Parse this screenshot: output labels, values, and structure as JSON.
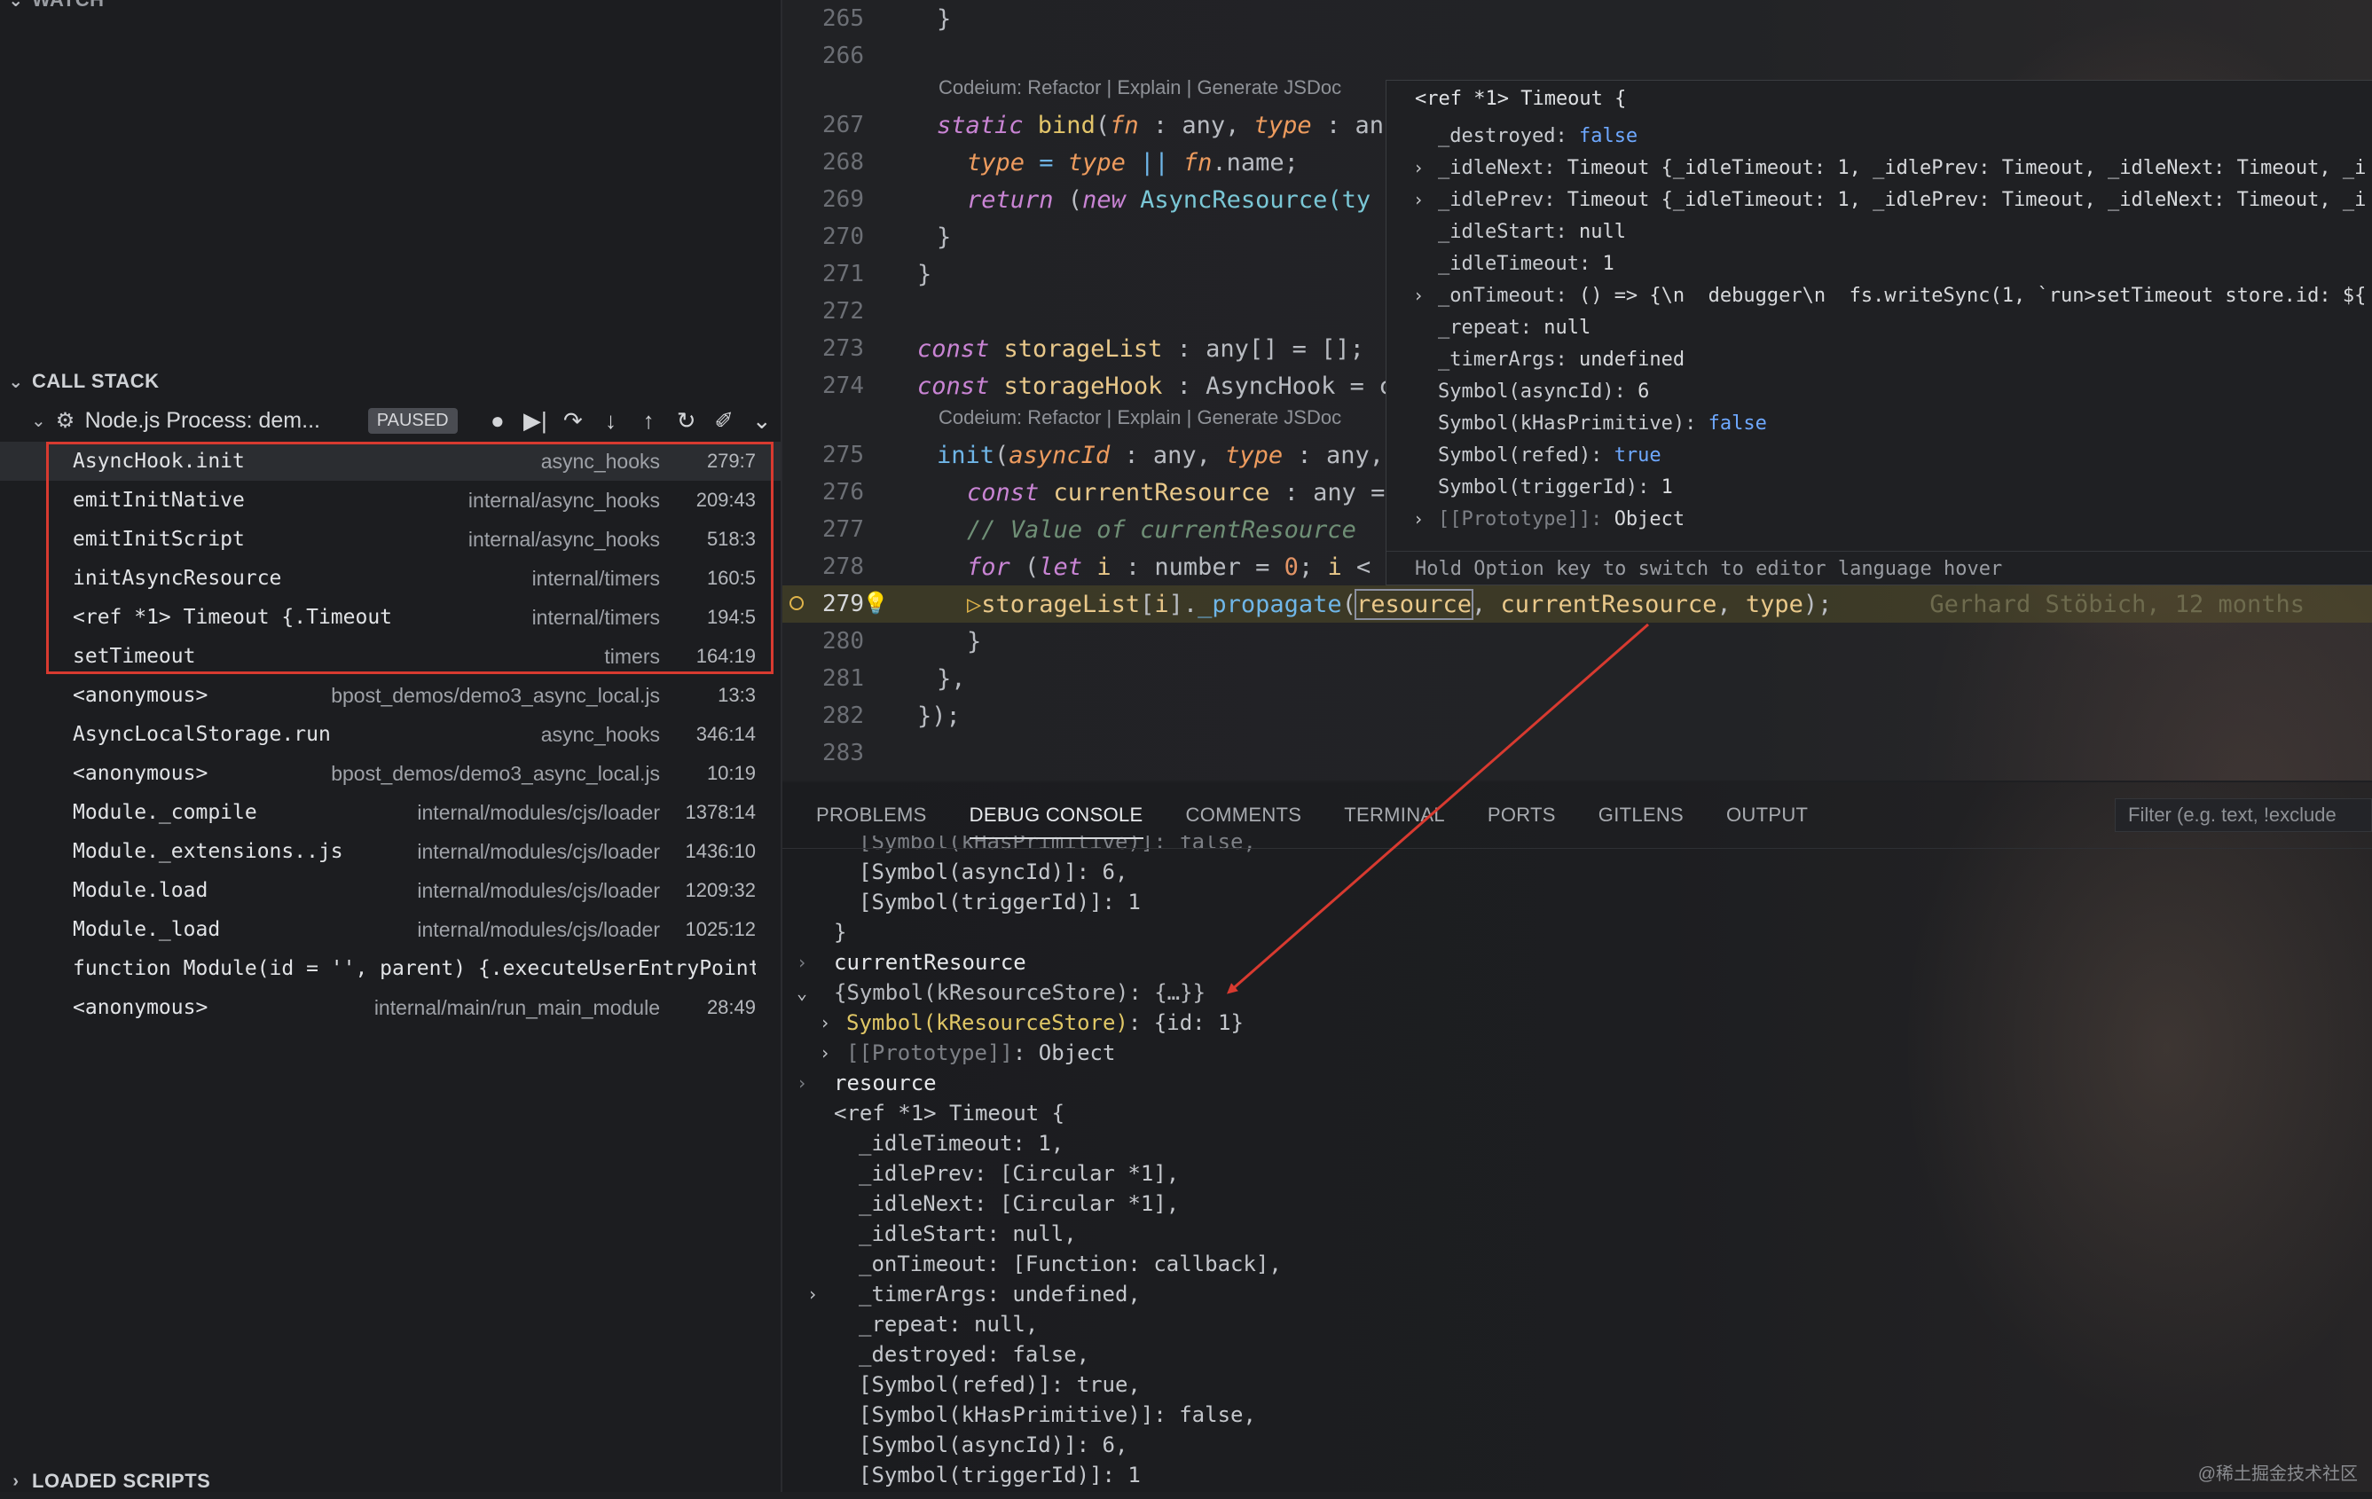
{
  "sidebar": {
    "watch_label": "WATCH",
    "callstack_label": "CALL STACK",
    "loaded_scripts_label": "LOADED SCRIPTS",
    "process_name": "Node.js Process: dem...",
    "status_badge": "PAUSED",
    "frames": [
      {
        "fn": "AsyncHook.init",
        "src": "async_hooks",
        "pos": "279:7"
      },
      {
        "fn": "emitInitNative",
        "src": "internal/async_hooks",
        "pos": "209:43"
      },
      {
        "fn": "emitInitScript",
        "src": "internal/async_hooks",
        "pos": "518:3"
      },
      {
        "fn": "initAsyncResource",
        "src": "internal/timers",
        "pos": "160:5"
      },
      {
        "fn": "<ref *1> Timeout {.Timeout",
        "src": "internal/timers",
        "pos": "194:5"
      },
      {
        "fn": "setTimeout",
        "src": "timers",
        "pos": "164:19"
      },
      {
        "fn": "<anonymous>",
        "src": "bpost_demos/demo3_async_local.js",
        "pos": "13:3"
      },
      {
        "fn": "AsyncLocalStorage.run",
        "src": "async_hooks",
        "pos": "346:14"
      },
      {
        "fn": "<anonymous>",
        "src": "bpost_demos/demo3_async_local.js",
        "pos": "10:19"
      },
      {
        "fn": "Module._compile",
        "src": "internal/modules/cjs/loader",
        "pos": "1378:14"
      },
      {
        "fn": "Module._extensions..js",
        "src": "internal/modules/cjs/loader",
        "pos": "1436:10"
      },
      {
        "fn": "Module.load",
        "src": "internal/modules/cjs/loader",
        "pos": "1209:32"
      },
      {
        "fn": "Module._load",
        "src": "internal/modules/cjs/loader",
        "pos": "1025:12"
      },
      {
        "fn": "function Module(id = '', parent) {.executeUserEntryPoint",
        "src": "",
        "pos": ""
      },
      {
        "fn": "<anonymous>",
        "src": "internal/main/run_main_module",
        "pos": "28:49"
      }
    ]
  },
  "editor": {
    "line_numbers": [
      "265",
      "266",
      "267",
      "268",
      "269",
      "270",
      "271",
      "272",
      "273",
      "274",
      "275",
      "276",
      "277",
      "278",
      "279",
      "280",
      "281",
      "282",
      "283"
    ],
    "codelens": "Codeium: Refactor | Explain | Generate JSDoc",
    "lines": {
      "l265": "}",
      "l267_a": "static ",
      "l267_b": "bind",
      "l267_c": "(",
      "l267_d": "fn",
      "l267_e": " : any, ",
      "l267_f": "type",
      "l267_g": " : an",
      "l268_a": "type",
      "l268_b": " = ",
      "l268_c": "type",
      "l268_d": " || ",
      "l268_e": "fn",
      "l268_f": ".name;",
      "l269_a": "return ",
      "l269_b": "(",
      "l269_c": "new ",
      "l269_d": "AsyncResource",
      "l269_e": "(ty",
      "l270": "}",
      "l271": "}",
      "l273_a": "const ",
      "l273_b": "storageList",
      "l273_c": " : any[] = [];",
      "l274_a": "const ",
      "l274_b": "storageHook",
      "l274_c": " : AsyncHook = c",
      "l275_a": "init",
      "l275_b": "(",
      "l275_c": "asyncId",
      "l275_d": " : any, ",
      "l275_e": "type",
      "l275_f": " : any,",
      "l276_a": "const ",
      "l276_b": "currentResource",
      "l276_c": " : any =",
      "l277": "// Value of currentResource",
      "l278_a": "for ",
      "l278_b": "(",
      "l278_c": "let ",
      "l278_d": "i",
      "l278_e": " : number = ",
      "l278_f": "0",
      "l278_g": "; ",
      "l278_h": "i",
      "l278_i": " <",
      "l279_a": "storageList",
      "l279_b": "[",
      "l279_c": "i",
      "l279_d": "].",
      "l279_e": "_propagate",
      "l279_f": "(",
      "l279_g": "resource",
      "l279_h": ", ",
      "l279_i": "currentResource",
      "l279_j": ", ",
      "l279_k": "type",
      "l279_l": ");",
      "l279_blame": "Gerhard Stöbich, 12 months",
      "l280": "}",
      "l281": "},",
      "l282": "});"
    }
  },
  "hover": {
    "title": "<ref *1> Timeout {",
    "rows": [
      {
        "twisty": "",
        "key": "_destroyed: ",
        "val": "false",
        "kind": "bool"
      },
      {
        "twisty": "›",
        "key": "_idleNext: ",
        "val": "Timeout {_idleTimeout: 1, _idlePrev: Timeout, _idleNext: Timeout, _i",
        "kind": "plain"
      },
      {
        "twisty": "›",
        "key": "_idlePrev: ",
        "val": "Timeout {_idleTimeout: 1, _idlePrev: Timeout, _idleNext: Timeout, _i",
        "kind": "plain"
      },
      {
        "twisty": "",
        "key": "_idleStart: ",
        "val": "null",
        "kind": "plain"
      },
      {
        "twisty": "",
        "key": "_idleTimeout: ",
        "val": "1",
        "kind": "plain"
      },
      {
        "twisty": "›",
        "key": "_onTimeout: ",
        "val": "() => {\\n  debugger\\n  fs.writeSync(1, `run>setTimeout store.id: ${",
        "kind": "plain"
      },
      {
        "twisty": "",
        "key": "_repeat: ",
        "val": "null",
        "kind": "plain"
      },
      {
        "twisty": "",
        "key": "_timerArgs: ",
        "val": "undefined",
        "kind": "plain"
      },
      {
        "twisty": "",
        "key": "Symbol(asyncId): ",
        "val": "6",
        "kind": "plain"
      },
      {
        "twisty": "",
        "key": "Symbol(kHasPrimitive): ",
        "val": "false",
        "kind": "bool"
      },
      {
        "twisty": "",
        "key": "Symbol(refed): ",
        "val": "true",
        "kind": "bool"
      },
      {
        "twisty": "",
        "key": "Symbol(triggerId): ",
        "val": "1",
        "kind": "plain"
      },
      {
        "twisty": "›",
        "key": "[[Prototype]]: ",
        "val": "Object",
        "kind": "proto"
      }
    ],
    "footer": "Hold Option key to switch to editor language hover"
  },
  "panel": {
    "tabs": [
      "PROBLEMS",
      "DEBUG CONSOLE",
      "COMMENTS",
      "TERMINAL",
      "PORTS",
      "GITLENS",
      "OUTPUT"
    ],
    "active_tab": "DEBUG CONSOLE",
    "filter_placeholder": "Filter (e.g. text, !exclude",
    "console": {
      "top_cut": "[Symbol(kHasPrimitive)]: false,",
      "a1": "[Symbol(asyncId)]: 6,",
      "a2": "[Symbol(triggerId)]: 1",
      "a3": "}",
      "cr_label": "currentResource",
      "cr_obj": "{Symbol(kResourceStore): {…}}",
      "cr_sym": "Symbol(kResourceStore)",
      "cr_sym_val": ": {id: 1}",
      "cr_proto": "[[Prototype]]",
      "cr_proto_val": ": Object",
      "res_label": "resource",
      "r0": "<ref *1> Timeout {",
      "r1": "_idleTimeout: 1,",
      "r2": "_idlePrev: [Circular *1],",
      "r3": "_idleNext: [Circular *1],",
      "r4": "_idleStart: null,",
      "r5": "_onTimeout: [Function: callback],",
      "r6": "_timerArgs: undefined,",
      "r7": "_repeat: null,",
      "r8": "_destroyed: false,",
      "r9": "[Symbol(refed)]: true,",
      "r10": "[Symbol(kHasPrimitive)]: false,",
      "r11": "[Symbol(asyncId)]: 6,",
      "r12": "[Symbol(triggerId)]: 1"
    }
  },
  "watermark": "@稀土掘金技术社区",
  "colors": {
    "highlight_box": "#d83a30",
    "annotation_arrow": "#d83a30",
    "accent_bool": "#6ea8ff"
  }
}
